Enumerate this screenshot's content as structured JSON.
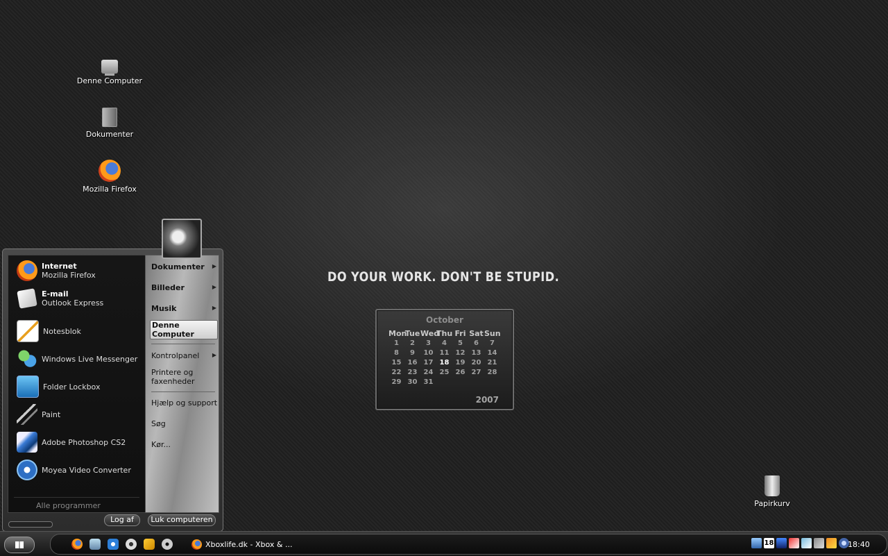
{
  "desktop": {
    "icons": [
      {
        "label": "Denne Computer",
        "icon": "computer-icon"
      },
      {
        "label": "Dokumenter",
        "icon": "documents-icon"
      },
      {
        "label": "Mozilla Firefox",
        "icon": "firefox-icon"
      },
      {
        "label": "Papirkurv",
        "icon": "recycle-bin-icon"
      }
    ],
    "slogan": "DO YOUR WORK. DON'T BE STUPID."
  },
  "calendar": {
    "month": "October",
    "year": "2007",
    "weekdays": [
      "Mon",
      "Tue",
      "Wed",
      "Thu",
      "Fri",
      "Sat",
      "Sun"
    ],
    "weeks": [
      [
        "1",
        "2",
        "3",
        "4",
        "5",
        "6",
        "7"
      ],
      [
        "8",
        "9",
        "10",
        "11",
        "12",
        "13",
        "14"
      ],
      [
        "15",
        "16",
        "17",
        "18",
        "19",
        "20",
        "21"
      ],
      [
        "22",
        "23",
        "24",
        "25",
        "26",
        "27",
        "28"
      ],
      [
        "29",
        "30",
        "31",
        "",
        "",
        "",
        ""
      ]
    ],
    "today": "18"
  },
  "start_menu": {
    "pinned": [
      {
        "title": "Internet",
        "subtitle": "Mozilla Firefox",
        "icon": "firefox-icon"
      },
      {
        "title": "E-mail",
        "subtitle": "Outlook Express",
        "icon": "mail-icon"
      }
    ],
    "recent": [
      {
        "label": "Notesblok",
        "icon": "notepad-icon"
      },
      {
        "label": "Windows Live Messenger",
        "icon": "messenger-icon"
      },
      {
        "label": "Folder Lockbox",
        "icon": "folder-lockbox-icon"
      },
      {
        "label": "Paint",
        "icon": "paint-icon"
      },
      {
        "label": "Adobe Photoshop CS2",
        "icon": "photoshop-icon"
      },
      {
        "label": "Moyea Video Converter",
        "icon": "video-converter-icon"
      }
    ],
    "all_programs": "Alle programmer",
    "places": [
      {
        "label": "Dokumenter"
      },
      {
        "label": "Billeder"
      },
      {
        "label": "Musik"
      },
      {
        "label": "Denne Computer"
      },
      {
        "label": "Kontrolpanel"
      },
      {
        "label": "Printere og faxenheder"
      },
      {
        "label": "Hjælp og support"
      },
      {
        "label": "Søg"
      },
      {
        "label": "Kør..."
      }
    ],
    "logoff_label": "Log af",
    "shutdown_label": "Luk computeren"
  },
  "taskbar": {
    "task_label": "Xboxlife.dk - Xbox & ...",
    "clock": "18:40",
    "tray_date": "18"
  }
}
